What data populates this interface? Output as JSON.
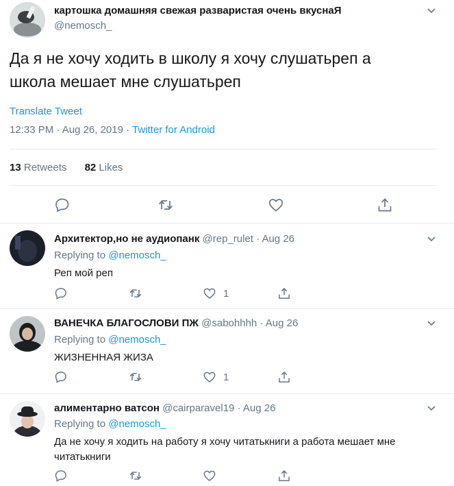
{
  "main_tweet": {
    "display_name": "картошка домашняя свежая разваристая очень вкуснаЯ",
    "handle": "@nemosch_",
    "text_line1": "Да я не хочу ходить в школу я хочу слушатьреп а",
    "text_line2": "школа мешает мне слушатьреп",
    "translate": "Translate Tweet",
    "time": "12:33 PM · Aug 26, 2019 · ",
    "source": "Twitter for Android",
    "retweets_count": "13",
    "retweets_label": " Retweets",
    "likes_count": "82",
    "likes_label": " Likes"
  },
  "replies": [
    {
      "display_name": "Архитектор,но не аудиопанк",
      "handle": "@rep_rulet",
      "date": " · Aug 26",
      "replying_label": "Replying to ",
      "replying_handle": "@nemosch_",
      "text_line1": "Реп мой реп",
      "text_line2": "",
      "like_count": "1"
    },
    {
      "display_name": "ВАНЕЧКА БЛАГОСЛОВИ ПЖ",
      "handle": "@sabohhhh",
      "date": " · Aug 26",
      "replying_label": "Replying to ",
      "replying_handle": "@nemosch_",
      "text_line1": "ЖИЗНЕННАЯ ЖИЗА",
      "text_line2": "",
      "like_count": "1"
    },
    {
      "display_name": "алиментарно ватсон",
      "handle": "@cairparavel19",
      "date": " · Aug 26",
      "replying_label": "Replying to ",
      "replying_handle": "@nemosch_",
      "text_line1": "Да не хочу я ходить на работу я хочу читатькниги а работа мешает мне",
      "text_line2": "читатькниги",
      "like_count": ""
    }
  ],
  "icons": [
    "reply-icon",
    "retweet-icon",
    "like-icon",
    "share-icon",
    "chevron-down-icon"
  ],
  "colors": {
    "link": "#1b95e0",
    "muted": "#657786",
    "divider": "#e6ecf0"
  }
}
